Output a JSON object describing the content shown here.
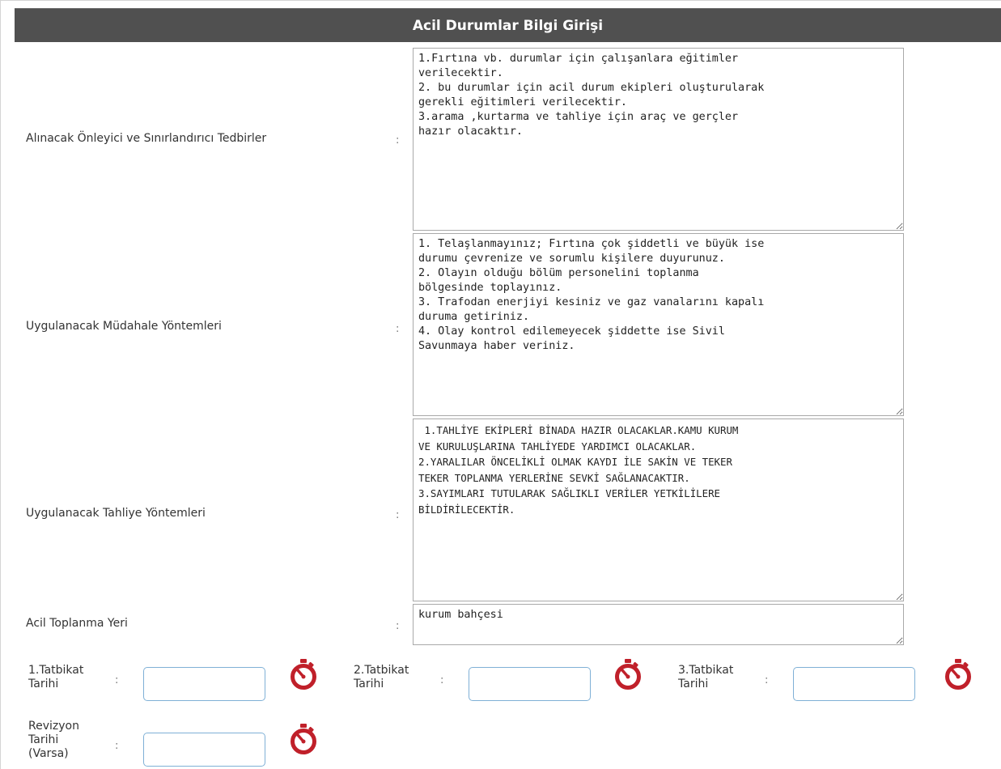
{
  "title": "Acil Durumlar Bilgi Girişi",
  "colon": ":",
  "fields": {
    "onleyici": {
      "label": "Alınacak Önleyici ve Sınırlandırıcı Tedbirler",
      "value": "1.Fırtına vb. durumlar için çalışanlara eğitimler\nverilecektir.\n2. bu durumlar için acil durum ekipleri oluşturularak\ngerekli eğitimleri verilecektir.\n3.arama ,kurtarma ve tahliye için araç ve gerçler\nhazır olacaktır."
    },
    "mudahale": {
      "label": "Uygulanacak Müdahale Yöntemleri",
      "value": "1. Telaşlanmayınız; Fırtına çok şiddetli ve büyük ise\ndurumu çevrenize ve sorumlu kişilere duyurunuz.\n2. Olayın olduğu bölüm personelini toplanma\nbölgesinde toplayınız.\n3. Trafodan enerjiyi kesiniz ve gaz vanalarını kapalı\nduruma getiriniz.\n4. Olay kontrol edilemeyecek şiddette ise Sivil\nSavunmaya haber veriniz."
    },
    "tahliye": {
      "label": "Uygulanacak Tahliye Yöntemleri",
      "value": " 1.TAHLİYE EKİPLERİ BİNADA HAZIR OLACAKLAR.KAMU KURUM\nVE KURULUŞLARINA TAHLİYEDE YARDIMCI OLACAKLAR.\n2.YARALILAR ÖNCELİKLİ OLMAK KAYDI İLE SAKİN VE TEKER\nTEKER TOPLANMA YERLERİNE SEVKİ SAĞLANACAKTIR.\n3.SAYIMLARI TUTULARAK SAĞLIKLI VERİLER YETKİLİLERE\nBİLDİRİLECEKTİR."
    },
    "toplanma": {
      "label": "Acil Toplanma Yeri",
      "value": "kurum bahçesi"
    }
  },
  "dates": {
    "tatbikat1": {
      "label": "1.Tatbikat\nTarihi",
      "value": ""
    },
    "tatbikat2": {
      "label": "2.Tatbikat\nTarihi",
      "value": ""
    },
    "tatbikat3": {
      "label": "3.Tatbikat\nTarihi",
      "value": ""
    },
    "revizyon": {
      "label": "Revizyon\nTarihi\n(Varsa)",
      "value": ""
    }
  },
  "icons": {
    "date_picker": "stopwatch-icon",
    "accent": "#c0202a"
  }
}
